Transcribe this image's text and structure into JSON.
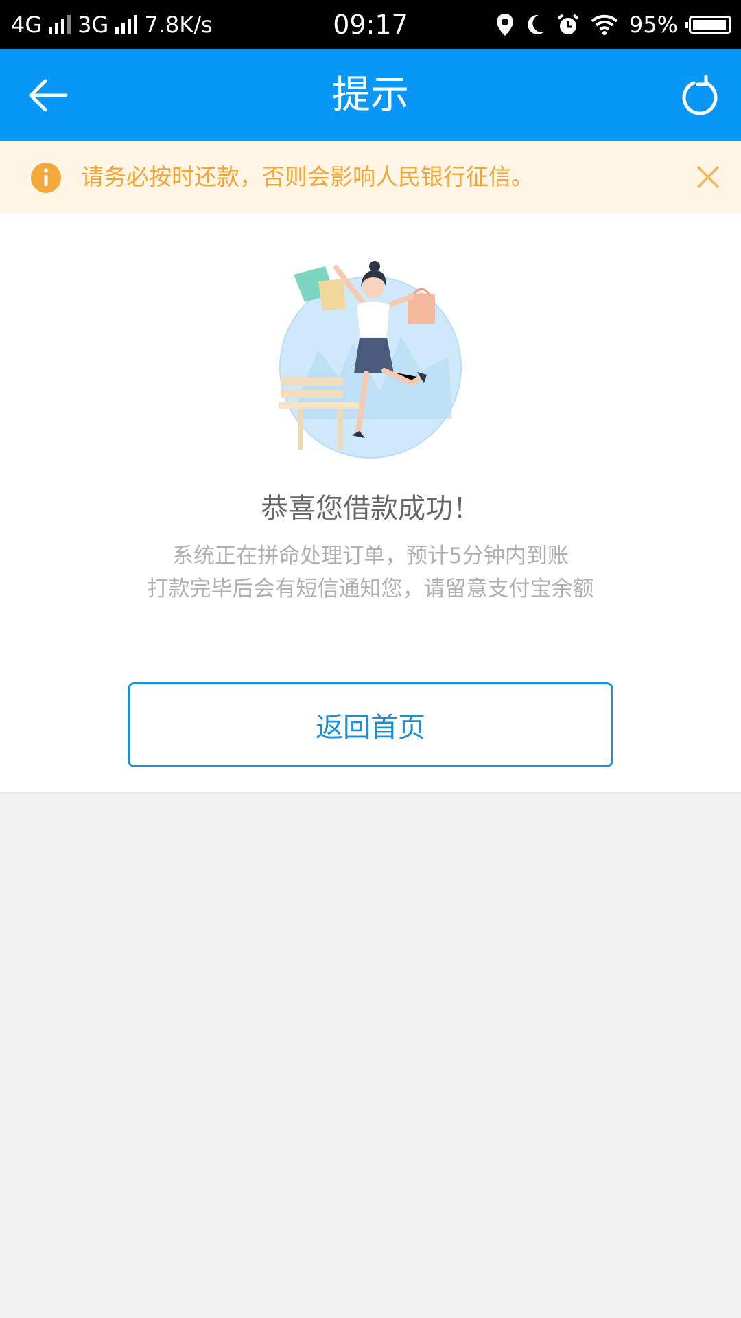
{
  "status_bar": {
    "network1": "4G",
    "network2": "3G",
    "speed": "7.8K/s",
    "time": "09:17",
    "battery": "95%",
    "icons": [
      "location-icon",
      "moon-icon",
      "alarm-icon",
      "wifi-icon",
      "battery-icon"
    ]
  },
  "header": {
    "title": "提示",
    "back_icon": "arrow-left-icon",
    "refresh_icon": "refresh-icon"
  },
  "notice": {
    "text": "请务必按时还款，否则会影响人民银行征信。",
    "icon": "info-icon",
    "close_icon": "close-icon",
    "color": "#f3a534"
  },
  "result": {
    "title": "恭喜您借款成功！",
    "line1": "系统正在拼命处理订单，预计5分钟内到账",
    "line2": "打款完毕后会有短信通知您，请留意支付宝余额"
  },
  "actions": {
    "home_label": "返回首页"
  },
  "colors": {
    "brand": "#0997f7",
    "button": "#1a90db"
  }
}
